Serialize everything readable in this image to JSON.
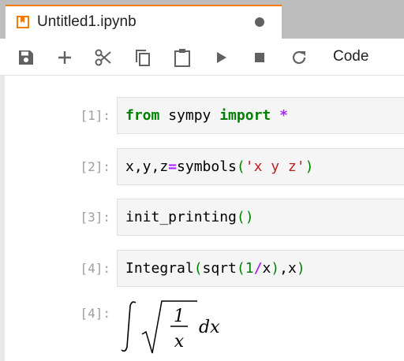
{
  "tab": {
    "title": "Untitled1.ipynb",
    "icon": "notebook-icon",
    "accent_color": "#f57c00",
    "modified": true
  },
  "toolbar": {
    "buttons": [
      "save-icon",
      "add-icon",
      "cut-icon",
      "copy-icon",
      "paste-icon",
      "run-icon",
      "stop-icon",
      "restart-icon"
    ],
    "cell_type": "Code"
  },
  "cells": [
    {
      "prompt": "[1]:",
      "tokens": [
        {
          "t": "from",
          "c": "kw"
        },
        {
          "t": " sympy ",
          "c": ""
        },
        {
          "t": "import",
          "c": "kw"
        },
        {
          "t": " ",
          "c": ""
        },
        {
          "t": "*",
          "c": "star"
        }
      ]
    },
    {
      "prompt": "[2]:",
      "tokens": [
        {
          "t": "x,y,z",
          "c": ""
        },
        {
          "t": "=",
          "c": "op"
        },
        {
          "t": "symbols",
          "c": ""
        },
        {
          "t": "(",
          "c": "par"
        },
        {
          "t": "'x y z'",
          "c": "str"
        },
        {
          "t": ")",
          "c": "par"
        }
      ]
    },
    {
      "prompt": "[3]:",
      "tokens": [
        {
          "t": "init_printing",
          "c": ""
        },
        {
          "t": "()",
          "c": "par"
        }
      ]
    },
    {
      "prompt": "[4]:",
      "tokens": [
        {
          "t": "Integral",
          "c": ""
        },
        {
          "t": "(",
          "c": "par"
        },
        {
          "t": "sqrt",
          "c": ""
        },
        {
          "t": "(",
          "c": "par"
        },
        {
          "t": "1",
          "c": "num"
        },
        {
          "t": "/",
          "c": "op"
        },
        {
          "t": "x",
          "c": ""
        },
        {
          "t": ")",
          "c": "par"
        },
        {
          "t": ",x",
          "c": ""
        },
        {
          "t": ")",
          "c": "par"
        }
      ]
    }
  ],
  "output": {
    "prompt": "[4]:",
    "numerator": "1",
    "denominator": "x",
    "differential": "dx"
  }
}
